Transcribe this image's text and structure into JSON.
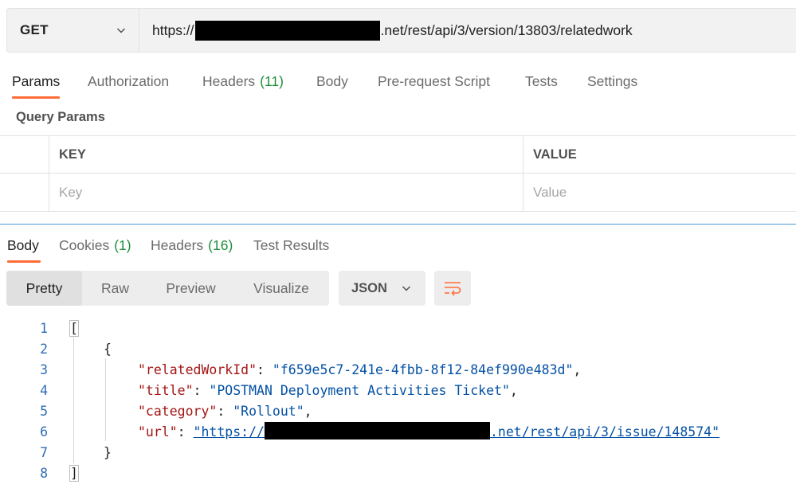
{
  "request": {
    "method": "GET",
    "url_prefix": "https://",
    "url_suffix": ".net/rest/api/3/version/13803/relatedwork"
  },
  "request_tabs": [
    {
      "label": "Params",
      "count": "",
      "active": true
    },
    {
      "label": "Authorization",
      "count": "",
      "active": false
    },
    {
      "label": "Headers",
      "count": "(11)",
      "active": false
    },
    {
      "label": "Body",
      "count": "",
      "active": false
    },
    {
      "label": "Pre-request Script",
      "count": "",
      "active": false
    },
    {
      "label": "Tests",
      "count": "",
      "active": false
    },
    {
      "label": "Settings",
      "count": "",
      "active": false
    }
  ],
  "query_params": {
    "title": "Query Params",
    "headers": {
      "key": "KEY",
      "value": "VALUE"
    },
    "placeholders": {
      "key": "Key",
      "value": "Value"
    }
  },
  "response_tabs": [
    {
      "label": "Body",
      "count": "",
      "active": true
    },
    {
      "label": "Cookies",
      "count": "(1)",
      "active": false
    },
    {
      "label": "Headers",
      "count": "(16)",
      "active": false
    },
    {
      "label": "Test Results",
      "count": "",
      "active": false
    }
  ],
  "view_modes": [
    {
      "label": "Pretty",
      "active": true
    },
    {
      "label": "Raw",
      "active": false
    },
    {
      "label": "Preview",
      "active": false
    },
    {
      "label": "Visualize",
      "active": false
    }
  ],
  "format": {
    "selected": "JSON"
  },
  "icons": {
    "wrap": "wrap-lines-icon",
    "dropdown": "chevron-down-icon"
  },
  "colors": {
    "accent": "#ff6c37",
    "count": "#1e8f3d",
    "json_key": "#a31515",
    "json_string": "#0451a5",
    "line_number": "#2d6db5"
  },
  "response_body": {
    "line_numbers": [
      "1",
      "2",
      "3",
      "4",
      "5",
      "6",
      "7",
      "8"
    ],
    "open_bracket": "[",
    "open_brace": "{",
    "fields": [
      {
        "key": "\"relatedWorkId\"",
        "value": "\"f659e5c7-241e-4fbb-8f12-84ef990e483d\"",
        "trail": ","
      },
      {
        "key": "\"title\"",
        "value": "\"POSTMAN Deployment Activities Ticket\"",
        "trail": ","
      },
      {
        "key": "\"category\"",
        "value": "\"Rollout\"",
        "trail": ","
      }
    ],
    "url_field": {
      "key": "\"url\"",
      "value_prefix": "\"https://",
      "value_suffix": ".net/rest/api/3/issue/148574\""
    },
    "close_brace": "}",
    "close_bracket": "]"
  }
}
